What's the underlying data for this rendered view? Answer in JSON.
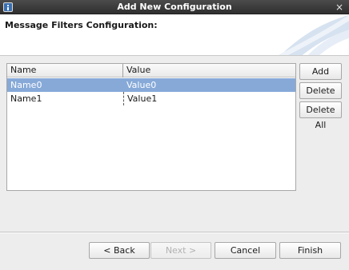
{
  "window": {
    "title": "Add New Configuration",
    "close_glyph": "×",
    "icon": "info-app-icon"
  },
  "banner": {
    "title": "Message Filters Configuration:"
  },
  "table": {
    "columns": [
      "Name",
      "Value"
    ],
    "rows": [
      {
        "name": "Name0",
        "value": "Value0",
        "selected": true
      },
      {
        "name": "Name1",
        "value": "Value1",
        "selected": false
      }
    ]
  },
  "side_buttons": {
    "add": "Add",
    "delete": "Delete",
    "delete_all": "Delete All"
  },
  "footer": {
    "back": "< Back",
    "next": "Next >",
    "next_enabled": false,
    "cancel": "Cancel",
    "finish": "Finish"
  },
  "colors": {
    "titlebar": "#3a3a3a",
    "selection": "#86a9d8",
    "dialog_bg": "#ededed"
  }
}
